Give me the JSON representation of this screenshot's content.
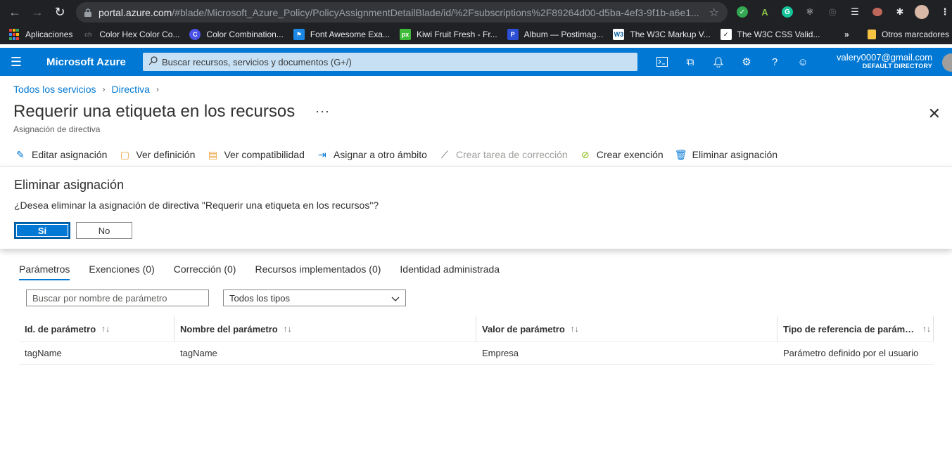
{
  "browser": {
    "url_domain": "portal.azure.com",
    "url_path": "/#blade/Microsoft_Azure_Policy/PolicyAssignmentDetailBlade/id/%2Fsubscriptions%2F89264d00-d5ba-4ef3-9f1b-a6e1...",
    "bookmarks": [
      {
        "label": "Aplicaciones",
        "icon": "apps-grid-icon",
        "color": "#ea4335"
      },
      {
        "label": "Color Hex Color Co...",
        "icon": "colorhex-icon",
        "color": "#5f6368"
      },
      {
        "label": "Color Combination...",
        "icon": "color-c-icon",
        "color": "#4a52e8"
      },
      {
        "label": "Font Awesome Exa...",
        "icon": "flag-icon",
        "color": "#1c88e5"
      },
      {
        "label": "Kiwi Fruit Fresh - Fr...",
        "icon": "px-icon",
        "color": "#3fbb3a"
      },
      {
        "label": "Album — Postimag...",
        "icon": "postimage-icon",
        "color": "#2d4fd6"
      },
      {
        "label": "The W3C Markup V...",
        "icon": "w3c-icon",
        "color": "#ffffff"
      },
      {
        "label": "The W3C CSS Valid...",
        "icon": "css-icon",
        "color": "#ffffff"
      }
    ],
    "bookmarks_overflow": "»",
    "other_bookmarks": "Otros marcadores"
  },
  "azure": {
    "brand": "Microsoft Azure",
    "search_placeholder": "Buscar recursos, servicios y documentos (G+/)",
    "account_email": "valery0007@gmail.com",
    "account_directory": "DEFAULT DIRECTORY",
    "accent": "#0078d4"
  },
  "breadcrumb": [
    "Todos los servicios",
    "Directiva"
  ],
  "page": {
    "title": "Requerir una etiqueta en los recursos",
    "subtitle": "Asignación de directiva",
    "more": "···"
  },
  "commands": [
    {
      "label": "Editar asignación",
      "icon": "pencil-icon",
      "disabled": false
    },
    {
      "label": "Ver definición",
      "icon": "document-icon",
      "disabled": false
    },
    {
      "label": "Ver compatibilidad",
      "icon": "compliance-icon",
      "disabled": false
    },
    {
      "label": "Asignar a otro ámbito",
      "icon": "assign-icon",
      "disabled": false
    },
    {
      "label": "Crear tarea de corrección",
      "icon": "remediation-icon",
      "disabled": true
    },
    {
      "label": "Crear exención",
      "icon": "exemption-icon",
      "disabled": false
    },
    {
      "label": "Eliminar asignación",
      "icon": "trash-icon",
      "disabled": false
    }
  ],
  "confirm": {
    "title": "Eliminar asignación",
    "message": "¿Desea eliminar la asignación de directiva \"Requerir una etiqueta en los recursos\"?",
    "yes": "Sí",
    "no": "No"
  },
  "tabs": [
    {
      "label": "Parámetros",
      "active": true
    },
    {
      "label": "Exenciones (0)",
      "active": false
    },
    {
      "label": "Corrección (0)",
      "active": false
    },
    {
      "label": "Recursos implementados (0)",
      "active": false
    },
    {
      "label": "Identidad administrada",
      "active": false
    }
  ],
  "filter": {
    "placeholder": "Buscar por nombre de parámetro",
    "type_selected": "Todos los tipos"
  },
  "table": {
    "columns": [
      "Id. de parámetro",
      "Nombre del parámetro",
      "Valor de parámetro",
      "Tipo de referencia de parámetro"
    ],
    "rows": [
      [
        "tagName",
        "tagName",
        "Empresa",
        "Parámetro definido por el usuario"
      ]
    ]
  }
}
